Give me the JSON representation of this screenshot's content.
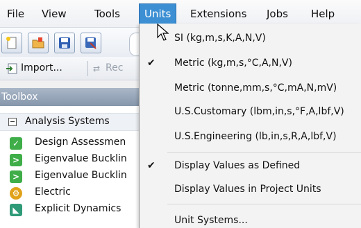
{
  "menubar": {
    "items": [
      {
        "label": "File"
      },
      {
        "label": "View"
      },
      {
        "label": "Tools"
      },
      {
        "label": "Units"
      },
      {
        "label": "Extensions"
      },
      {
        "label": "Jobs"
      },
      {
        "label": "Help"
      }
    ],
    "active_color": "#3c8fd3"
  },
  "toolbar": {
    "buttons": [
      {
        "icon": "new-project-icon"
      },
      {
        "icon": "open-folder-icon"
      },
      {
        "icon": "save-icon"
      },
      {
        "icon": "save-as-icon"
      }
    ]
  },
  "import_row": {
    "import_label": "Import...",
    "reconnect_label": "Rec"
  },
  "toolbox": {
    "title": "Toolbox",
    "group": "Analysis Systems",
    "items": [
      {
        "label": "Design Assessmen",
        "icon": "design-assessment-icon"
      },
      {
        "label": "Eigenvalue Bucklin",
        "icon": "eigenvalue-buckling-icon"
      },
      {
        "label": "Eigenvalue Bucklin",
        "icon": "eigenvalue-buckling-icon"
      },
      {
        "label": "Electric",
        "icon": "electric-icon"
      },
      {
        "label": "Explicit Dynamics",
        "icon": "explicit-dynamics-icon"
      }
    ]
  },
  "units_menu": {
    "items": [
      {
        "label": "SI (kg,m,s,K,A,N,V)",
        "checked": false
      },
      {
        "label": "Metric (kg,m,s,°C,A,N,V)",
        "checked": true
      },
      {
        "label": "Metric (tonne,mm,s,°C,mA,N,mV)",
        "checked": false
      },
      {
        "label": "U.S.Customary (lbm,in,s,°F,A,lbf,V)",
        "checked": false
      },
      {
        "label": "U.S.Engineering (lb,in,s,R,A,lbf,V)",
        "checked": false
      },
      {
        "label": "Display Values as Defined",
        "checked": true
      },
      {
        "label": "Display Values in Project Units",
        "checked": false
      },
      {
        "label": "Unit Systems...",
        "checked": false
      }
    ],
    "check_glyph": "✔"
  }
}
